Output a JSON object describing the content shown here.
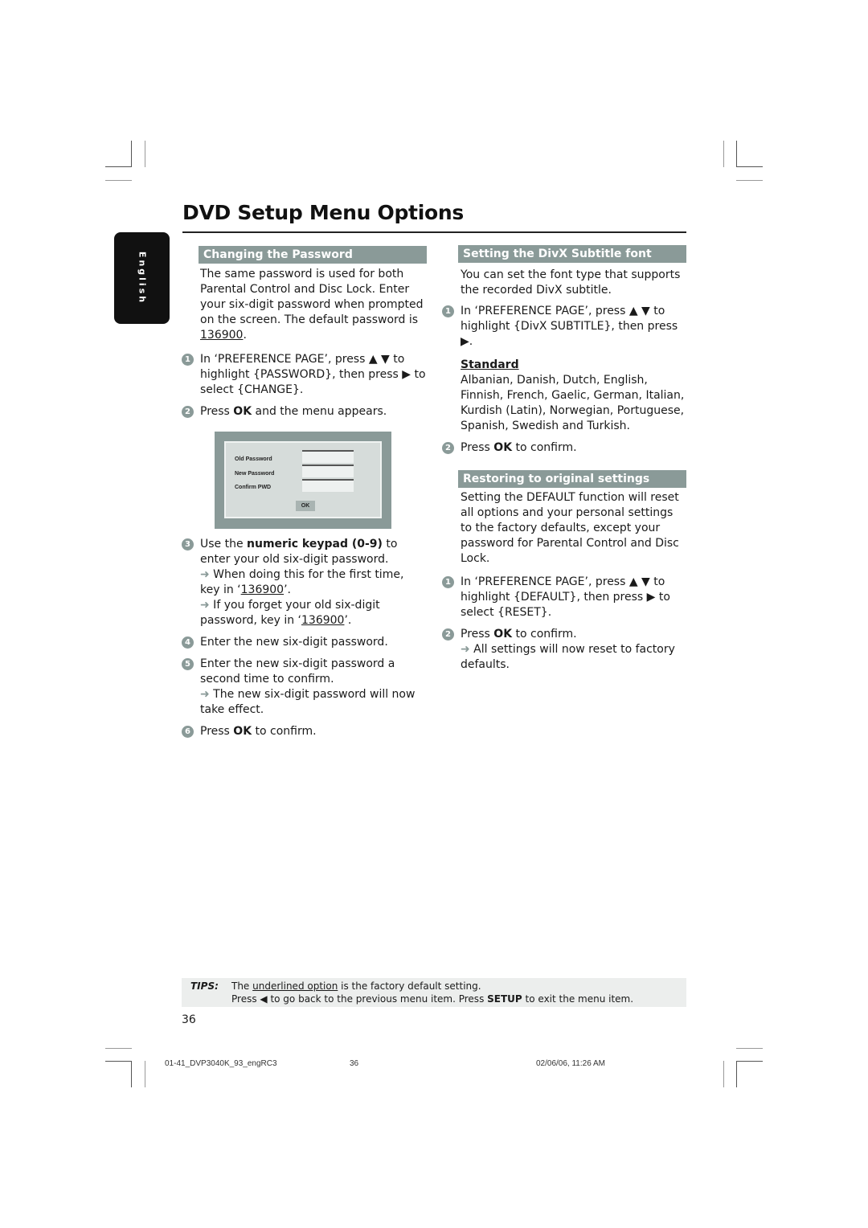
{
  "page": {
    "title": "DVD Setup Menu Options",
    "language_tab": "English",
    "page_number": "36"
  },
  "left_column": {
    "section_title": "Changing the Password",
    "intro": "The same password is used for both Parental Control and Disc Lock.  Enter your six-digit password when prompted on the screen. The default password is ",
    "intro_default": "136900",
    "intro_end": ".",
    "step1": {
      "num": "1",
      "text": "In ‘PREFERENCE PAGE’, press ▲ ▼ to highlight {PASSWORD}, then press ▶ to select {CHANGE}."
    },
    "step2": {
      "num": "2",
      "pre": "Press ",
      "bold": "OK",
      "post": " and the menu appears."
    },
    "osd": {
      "old_password_label": "Old Password",
      "new_password_label": "New Password",
      "confirm_label": "Confirm PWD",
      "ok_label": "OK"
    },
    "step3": {
      "num": "3",
      "pre": "Use the ",
      "bold": "numeric keypad (0-9)",
      "post": " to enter your old six-digit password.",
      "note1_pre": " When doing this for the first time, key in ‘",
      "note1_code": "136900",
      "note1_post": "’.",
      "note2_pre": " If you forget your old six-digit password, key in ‘",
      "note2_code": "136900",
      "note2_post": "’."
    },
    "step4": {
      "num": "4",
      "text": "Enter the new six-digit password."
    },
    "step5": {
      "num": "5",
      "text": "Enter the new six-digit password a second time to confirm.",
      "note": " The new six-digit password will now take effect."
    },
    "step6": {
      "num": "6",
      "pre": "Press ",
      "bold": "OK",
      "post": " to confirm."
    }
  },
  "right_column": {
    "divx": {
      "section_title": "Setting the DivX Subtitle font",
      "intro": "You can set the font type that supports the recorded DivX subtitle.",
      "step1": {
        "num": "1",
        "text": "In ‘PREFERENCE PAGE’, press ▲ ▼ to highlight {DivX SUBTITLE}, then press ▶."
      },
      "option_title": "Standard",
      "option_langs": "Albanian, Danish, Dutch, English, Finnish, French, Gaelic, German, Italian, Kurdish (Latin), Norwegian, Portuguese, Spanish, Swedish and Turkish.",
      "step2": {
        "num": "2",
        "pre": "Press ",
        "bold": "OK",
        "post": " to confirm."
      }
    },
    "restore": {
      "section_title": "Restoring to original settings",
      "intro": "Setting the DEFAULT function will reset all options and your personal settings to the factory defaults, except your password for Parental Control and Disc Lock.",
      "step1": {
        "num": "1",
        "text": "In ‘PREFERENCE PAGE’, press ▲ ▼ to highlight {DEFAULT}, then press ▶  to select {RESET}."
      },
      "step2": {
        "num": "2",
        "pre": "Press ",
        "bold": "OK",
        "post": " to confirm.",
        "note": " All settings will now reset to factory defaults."
      }
    }
  },
  "tips": {
    "label": "TIPS:",
    "line1_pre": "The ",
    "line1_underlined": "underlined option",
    "line1_post": " is the factory default setting.",
    "line2_pre": "Press ◀ to go back to the previous menu item. Press ",
    "line2_bold": "SETUP",
    "line2_post": " to exit the menu item."
  },
  "footer": {
    "file": "01-41_DVP3040K_93_engRC3",
    "page": "36",
    "timestamp": "02/06/06, 11:26 AM"
  },
  "colors": {
    "section_header_bg": "#8a9a98",
    "tips_bg": "#eceeed",
    "lang_tab_bg": "#111111"
  }
}
